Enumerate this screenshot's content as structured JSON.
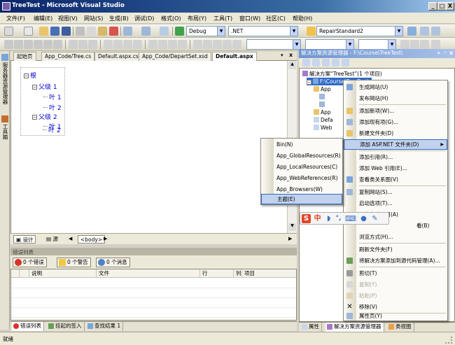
{
  "window": {
    "title": "TreeTest - Microsoft Visual Studio",
    "controls": [
      "_",
      "□",
      "X"
    ]
  },
  "menubar": [
    "文件(F)",
    "编辑(E)",
    "视图(V)",
    "网站(S)",
    "生成(B)",
    "调试(D)",
    "格式(O)",
    "布局(Y)",
    "工具(T)",
    "窗口(W)",
    "社区(C)",
    "帮助(H)"
  ],
  "toolbar": {
    "config": "Debug",
    "platform": ".NET",
    "solution_target": "RepairStandard2"
  },
  "left_strip": {
    "server_explorer": "服务器资源管理器",
    "toolbox": "工具箱"
  },
  "document_tabs": [
    "起始页",
    "App_Code/Tree.cs",
    "Default.aspx.cs",
    "App_Code/DepartSet.xsd",
    "Default.aspx"
  ],
  "document_tab_controls": [
    "▾",
    "x"
  ],
  "tree": {
    "root": "根",
    "parent1": "父级 1",
    "child11": "叶 1",
    "child12": "叶 2",
    "parent2": "父级 2",
    "child21": "叶 1",
    "child22": "叶 2"
  },
  "view_bar": {
    "design": "设计",
    "source": "源",
    "tag": "<body>"
  },
  "error_list": {
    "header": "错误列表",
    "errors": "0 个错误",
    "warnings": "0 个警告",
    "messages": "0 个消息",
    "columns": [
      "说明",
      "文件",
      "行",
      "列",
      "项目"
    ]
  },
  "bottom_tabs": [
    "错误列表",
    "挂起的签入",
    "查找结果 1"
  ],
  "solution_explorer": {
    "header": "解决方案资源管理器 - F:\\Course\\TreeTest\\",
    "solution": "解决方案“TreeTest”(1 个项目)",
    "project": "F:\\Course\\TreeTest\\",
    "rows": [
      "App",
      "App",
      "Defa",
      "Web"
    ]
  },
  "side_tabs": [
    "属性",
    "解决方案资源管理器",
    "类视图"
  ],
  "context_menu": {
    "items": [
      "生成网站(U)",
      "发布网站(H)",
      "添加新项(W)...",
      "添加现有项(G)...",
      "新建文件夹(D)",
      "添加 ASP.NET 文件夹(D)",
      "添加引用(R)...",
      "添加 Web 引用(E)...",
      "查看类关系图(V)",
      "复制网站(S)...",
      "启动选项(T)...",
      "设为启动项目(A)",
      "看(B)",
      "浏览方式(H)...",
      "刷新文件夹(F)",
      "将解决方案添加到源代码管理(A)...",
      "剪切(T)",
      "复制(Y)",
      "粘贴(P)",
      "移除(V)",
      "属性页(Y)"
    ]
  },
  "submenu": {
    "items": [
      "Bin(N)",
      "App_GlobalResources(R)",
      "App_LocalResources(C)",
      "App_WebReferences(R)",
      "App_Browsers(W)",
      "主题(E)"
    ]
  },
  "ime": {
    "logo": "S",
    "lang": "中"
  },
  "status": {
    "text": "就绪"
  }
}
